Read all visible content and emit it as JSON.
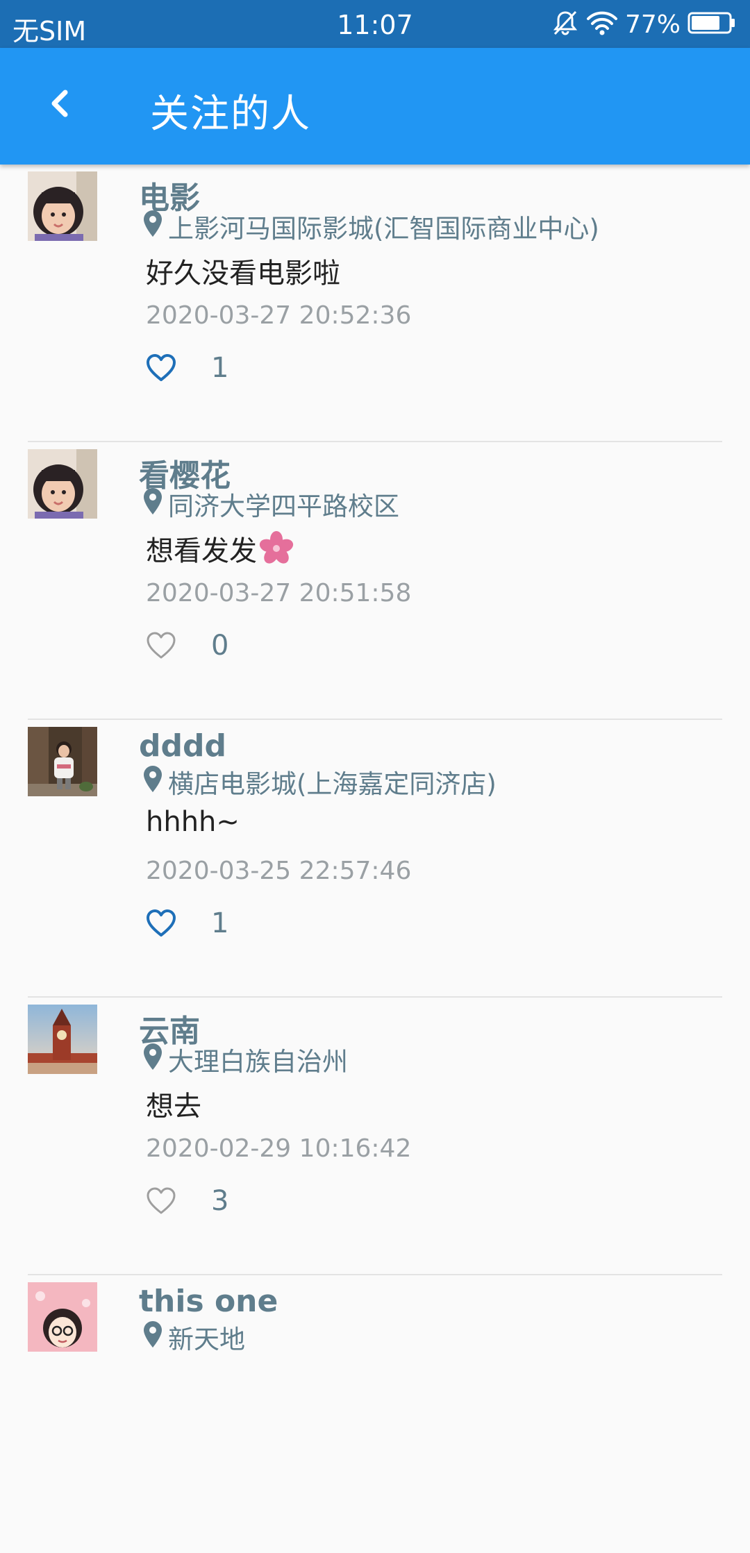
{
  "status_bar": {
    "carrier": "无SIM",
    "time": "11:07",
    "battery": "77%",
    "battery_level": 0.77
  },
  "header": {
    "title": "关注的人",
    "back_icon": "chevron-left-icon"
  },
  "colors": {
    "status_bar": "#1c6eb4",
    "app_bar": "#2196f3",
    "liked": "#1e6fb8",
    "unliked": "#9e9e9e",
    "author": "#5f7d8c"
  },
  "posts": [
    {
      "author": "电影",
      "location": "上影河马国际影城(汇智国际商业中心)",
      "content": "好久没看电影啦",
      "timestamp": "2020-03-27 20:52:36",
      "likes": "1",
      "liked": true
    },
    {
      "author": "看樱花",
      "location": "同济大学四平路校区",
      "content": "想看发发",
      "content_emoji": "cherry-blossom-icon",
      "timestamp": "2020-03-27 20:51:58",
      "likes": "0",
      "liked": false
    },
    {
      "author": "dddd",
      "location": "横店电影城(上海嘉定同济店)",
      "content": "hhhh~",
      "timestamp": "2020-03-25 22:57:46",
      "likes": "1",
      "liked": true
    },
    {
      "author": "云南",
      "location": "大理白族自治州",
      "content": "想去",
      "timestamp": "2020-02-29 10:16:42",
      "likes": "3",
      "liked": false
    },
    {
      "author": "this one",
      "location": "新天地",
      "content": "",
      "timestamp": "",
      "likes": "",
      "liked": false
    }
  ]
}
